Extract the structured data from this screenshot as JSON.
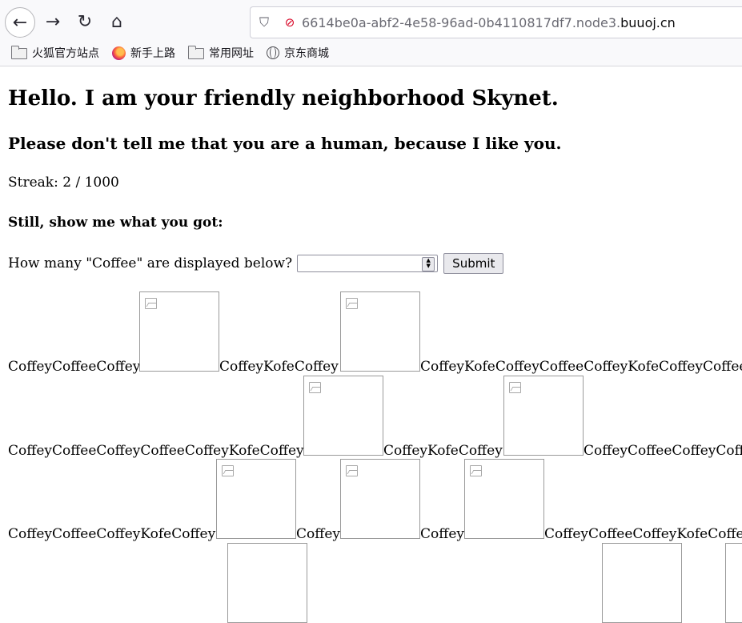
{
  "browser": {
    "url_prefix": "6614be0a-abf2-4e58-96ad-0b4110817df7.node3.",
    "url_domain": "buuoj.cn",
    "bookmarks": [
      {
        "label": "火狐官方站点",
        "icon": "folder-icon"
      },
      {
        "label": "新手上路",
        "icon": "firefox-icon"
      },
      {
        "label": "常用网址",
        "icon": "folder-icon"
      },
      {
        "label": "京东商城",
        "icon": "globe-icon"
      }
    ]
  },
  "page": {
    "title": "Hello. I am your friendly neighborhood Skynet.",
    "subtitle": "Please don't tell me that you are a human, because I like you.",
    "streak": "Streak: 2 / 1000",
    "challenge": "Still, show me what you got:",
    "question": "How many \"Coffee\" are displayed below?",
    "answer_value": "",
    "submit_label": "Submit"
  },
  "words": {
    "row1": [
      "CoffeyCoffeeCoffey",
      "CoffeyKofeCoffey",
      "CoffeyKofeCoffeyCoffeeCoffeyKofeCoffeyCoffee"
    ],
    "row2": [
      "CoffeyCoffeeCoffeyCoffeeCoffeyKofeCoffey",
      "CoffeyKofeCoffey",
      "CoffeyCoffeeCoffeyCoffee"
    ],
    "row3": [
      "CoffeyCoffeeCoffeyKofeCoffey",
      "Coffey",
      "Coffey",
      "CoffeyCoffeeCoffeyKofeCoffee"
    ]
  }
}
